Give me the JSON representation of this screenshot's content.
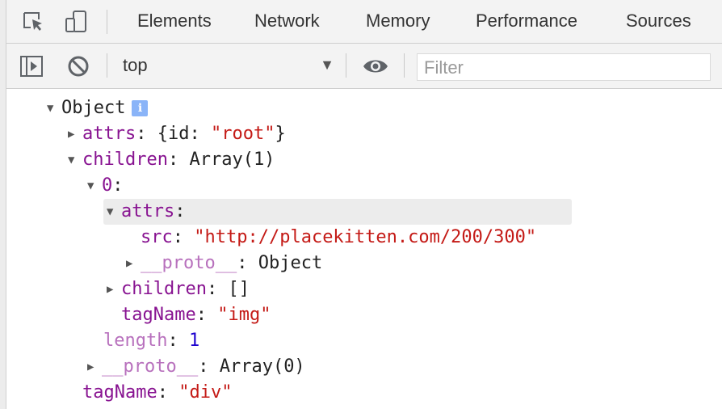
{
  "tabs": [
    "Elements",
    "Network",
    "Memory",
    "Performance",
    "Sources"
  ],
  "toolbar": {
    "context_value": "top",
    "filter_placeholder": "Filter"
  },
  "icons": {
    "inspect": "inspect-element-icon",
    "device": "device-toolbar-icon",
    "sidebar": "show-sidebar-icon",
    "clear": "clear-console-icon",
    "eye": "live-expression-icon",
    "info": "info-icon"
  },
  "colors": {
    "key_purple": "#881391",
    "key_faded": "#b871bd",
    "string_red": "#c41a16",
    "number_blue": "#1c00cf"
  },
  "tree": {
    "root_label": "Object",
    "info_glyph": "i",
    "attrs_key": "attrs",
    "attrs_preview": "{id: ",
    "attrs_preview_val": "\"root\"",
    "attrs_preview_end": "}",
    "children_key": "children",
    "children_val": "Array(1)",
    "index0_key": "0",
    "inner_attrs_key": "attrs",
    "src_key": "src",
    "src_val": "\"http://placekitten.com/200/300\"",
    "proto1_key": "__proto__",
    "proto1_val": "Object",
    "inner_children_key": "children",
    "inner_children_val": "[]",
    "img_tag_key": "tagName",
    "img_tag_val": "\"img\"",
    "length_key": "length",
    "length_val": "1",
    "proto2_key": "__proto__",
    "proto2_val": "Array(0)",
    "div_tag_key": "tagName",
    "div_tag_val": "\"div\""
  }
}
